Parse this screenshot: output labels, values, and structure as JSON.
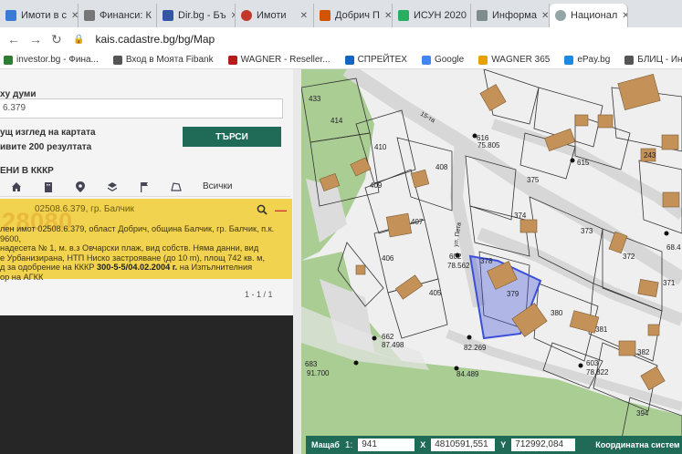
{
  "tabs": [
    {
      "label": "Имоти в с",
      "color": "#3a7bd5",
      "active": false
    },
    {
      "label": "Финанси: К",
      "color": "#777777",
      "active": false
    },
    {
      "label": "Dir.bg - Бъ",
      "color": "#3555a5",
      "active": false
    },
    {
      "label": "Имоти",
      "color": "#c0392b",
      "active": false
    },
    {
      "label": "Добрич П",
      "color": "#d35400",
      "active": false
    },
    {
      "label": "ИСУН 2020",
      "color": "#27ae60",
      "active": false
    },
    {
      "label": "Информа",
      "color": "#7f8c8d",
      "active": false
    },
    {
      "label": "Национал",
      "color": "#95a5a6",
      "active": true
    }
  ],
  "address": {
    "url": "kais.cadastre.bg/bg/Map"
  },
  "bookmarks": [
    {
      "label": "investor.bg - Фина...",
      "color": "#2e7d32"
    },
    {
      "label": "Вход в Моята Fibank",
      "color": "#555555"
    },
    {
      "label": "WAGNER - Reseller...",
      "color": "#b71c1c"
    },
    {
      "label": "СПРЕЙТЕХ",
      "color": "#1565c0"
    },
    {
      "label": "Google",
      "color": "#4285f4"
    },
    {
      "label": "WAGNER 365",
      "color": "#e6a100"
    },
    {
      "label": "ePay.bg",
      "color": "#1e88e5"
    },
    {
      "label": "БЛИЦ - Информаци...",
      "color": "#555555"
    }
  ],
  "panel": {
    "label_words": "ху думи",
    "search_value": "6.379",
    "check_view": "ущ изглед на картата",
    "check_results": "ивите 200 резултата",
    "search_button": "ТЪРСИ",
    "kkkr_label": "ЕНИ В КККР",
    "tools_all": "Всички"
  },
  "result": {
    "big_number": "28080",
    "title": "02508.6.379, гр. Балчик",
    "line1": "лен имот 02508.6.379, област Добрич, община Балчик, гр. Балчик, п.к. 9600,",
    "line2": "надесета № 1, м. в.з Овчарски плаж, вид собств. Няма данни, вид",
    "line3": "е Урбанизирана, НТП Ниско застрояване (до 10 m), площ 742 кв. м,",
    "line4_pre": "д за одобрение на КККР ",
    "line4_bold": "300-5-5/04.02.2004 г.",
    "line4_post": " на Изпълнителния",
    "line5": "ор на АГКК",
    "pager": "1 - 1 / 1"
  },
  "map_labels": {
    "parcels": [
      "414",
      "433",
      "410",
      "409",
      "408",
      "407",
      "406",
      "405",
      "375",
      "374",
      "373",
      "372",
      "371",
      "378",
      "379",
      "380",
      "381",
      "382",
      "243",
      "394",
      "15"
    ],
    "points": [
      "75.805",
      "78.562",
      "82.269",
      "87.498",
      "91.700",
      "84.489",
      "78.822",
      "68.4",
      "615",
      "616",
      "602",
      "662",
      "683",
      "603"
    ],
    "streets": [
      "ул. Пета",
      "15-та"
    ]
  },
  "status": {
    "scale_label": "Мащаб",
    "scale_value": "1:",
    "scale_num": "941",
    "x_label": "X",
    "x_value": "4810591,551",
    "y_label": "Y",
    "y_value": "712992,084",
    "system": "Координатна систем"
  },
  "colors": {
    "green_button": "#1f6b57",
    "result_bg": "#f2d34f",
    "building": "#c49159",
    "highlight": "#3b4fd8",
    "vegetation": "#a9cd93"
  }
}
